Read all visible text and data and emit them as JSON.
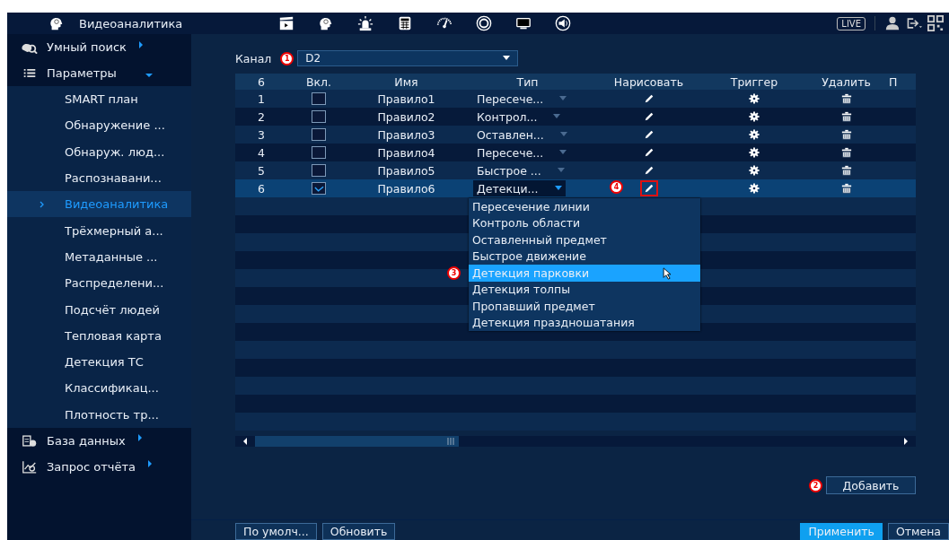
{
  "header": {
    "title": "Видеоаналитика",
    "live": "LIVE"
  },
  "sidebar": {
    "items": [
      {
        "label": "Умный поиск",
        "expanded": false
      },
      {
        "label": "Параметры",
        "expanded": true,
        "children": [
          {
            "label": "SMART план",
            "selected": false
          },
          {
            "label": "Обнаружение ...",
            "selected": false
          },
          {
            "label": "Обнаруж. люд...",
            "selected": false
          },
          {
            "label": "Распознавани...",
            "selected": false
          },
          {
            "label": "Видеоаналитика",
            "selected": true
          },
          {
            "label": "Трёхмерный а...",
            "selected": false
          },
          {
            "label": "Метаданные ...",
            "selected": false
          },
          {
            "label": "Распределени...",
            "selected": false
          },
          {
            "label": "Подсчёт людей",
            "selected": false
          },
          {
            "label": "Тепловая карта",
            "selected": false
          },
          {
            "label": "Детекция ТС",
            "selected": false
          },
          {
            "label": "Классификац...",
            "selected": false
          },
          {
            "label": "Плотность тр...",
            "selected": false
          }
        ]
      },
      {
        "label": "База данных",
        "expanded": false
      },
      {
        "label": "Запрос отчёта",
        "expanded": false
      }
    ]
  },
  "channel": {
    "label": "Канал",
    "value": "D2",
    "callout": "1"
  },
  "table": {
    "columns": [
      "6",
      "Вкл.",
      "Имя",
      "Тип",
      "Нарисовать",
      "Триггер",
      "Удалить",
      "П"
    ],
    "rows": [
      {
        "num": "1",
        "enabled": false,
        "name": "Правило1",
        "type": "Пересече...",
        "selected": false,
        "open": false,
        "draw_marked": false
      },
      {
        "num": "2",
        "enabled": false,
        "name": "Правило2",
        "type": "Контрол...",
        "selected": false,
        "open": false,
        "draw_marked": false
      },
      {
        "num": "3",
        "enabled": false,
        "name": "Правило3",
        "type": "Оставлен...",
        "selected": false,
        "open": false,
        "draw_marked": false
      },
      {
        "num": "4",
        "enabled": false,
        "name": "Правило4",
        "type": "Пересече...",
        "selected": false,
        "open": false,
        "draw_marked": false
      },
      {
        "num": "5",
        "enabled": false,
        "name": "Правило5",
        "type": "Быстрое ...",
        "selected": false,
        "open": false,
        "draw_marked": false
      },
      {
        "num": "6",
        "enabled": true,
        "name": "Правило6",
        "type": "Детекци...",
        "selected": true,
        "open": true,
        "draw_marked": true,
        "draw_callout": "4"
      }
    ]
  },
  "type_options": [
    {
      "label": "Пересечение линии",
      "selected": false
    },
    {
      "label": "Контроль области",
      "selected": false
    },
    {
      "label": "Оставленный предмет",
      "selected": false
    },
    {
      "label": "Быстрое движение",
      "selected": false
    },
    {
      "label": "Детекция парковки",
      "selected": true,
      "callout": "3"
    },
    {
      "label": "Детекция толпы",
      "selected": false
    },
    {
      "label": "Пропавший предмет",
      "selected": false
    },
    {
      "label": "Детекция праздношатания",
      "selected": false
    }
  ],
  "add_button": {
    "label": "Добавить",
    "callout": "2"
  },
  "footer_buttons": [
    {
      "label": "По умолч...",
      "kind": "normal"
    },
    {
      "label": "Обновить",
      "kind": "normal"
    },
    {
      "label": "Применить",
      "kind": "primary"
    },
    {
      "label": "Отмена",
      "kind": "normal"
    }
  ]
}
